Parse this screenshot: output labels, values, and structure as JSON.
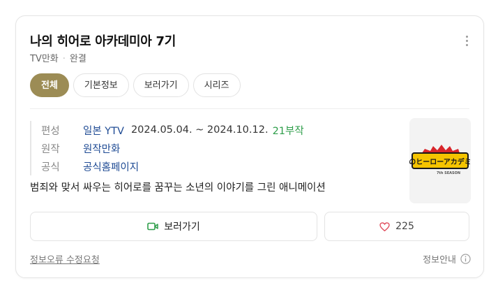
{
  "card": {
    "title": "나의 히어로 아카데미아 7기",
    "subtitle": {
      "type": "TV만화",
      "status": "완결"
    },
    "tabs": [
      {
        "label": "전체",
        "active": true
      },
      {
        "label": "기본정보",
        "active": false
      },
      {
        "label": "보러가기",
        "active": false
      },
      {
        "label": "시리즈",
        "active": false
      }
    ],
    "info": {
      "broadcast_label": "편성",
      "broadcast_channel": "일본 YTV",
      "broadcast_dates": "2024.05.04. ~ 2024.10.12.",
      "episodes": "21부작",
      "original_label": "원작",
      "original_value": "원작만화",
      "official_label": "공식",
      "official_value": "공식홈페이지"
    },
    "description": "범죄와 맞서 싸우는 히어로를 꿈꾸는 소년의 이야기를 그린 애니메이션",
    "poster": {
      "logo_text": "僕のヒーローアカデミア",
      "season_text": "7th SEASON"
    },
    "buttons": {
      "watch": "보러가기",
      "like_count": "225"
    },
    "footer": {
      "report": "정보오류 수정요청",
      "info": "정보안내"
    }
  },
  "colors": {
    "accent": "#9c8c55",
    "link": "#1f4b94",
    "green": "#2e9e4a",
    "heart": "#e04a5a"
  }
}
